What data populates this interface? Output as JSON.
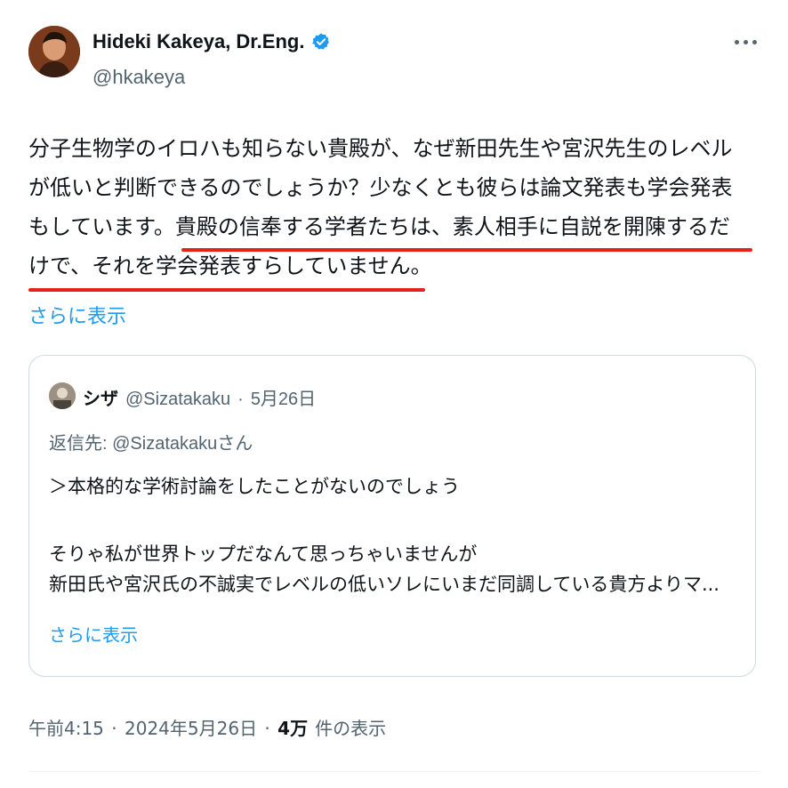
{
  "author": {
    "name": "Hideki Kakeya, Dr.Eng.",
    "handle": "@hkakeya"
  },
  "tweet": {
    "line1": "分子生物学のイロハも知らない貴殿が、なぜ新田先生や宮沢先生のレベル",
    "line2": "が低いと判断できるのでしょうか？少なくとも彼らは論文発表も学会発表",
    "line3_plain": "もしています。",
    "line3_highlight": "貴殿の信奉する学者たちは、素人相手に自説を開陳するだ",
    "line4_highlight": "けで、それを学会発表すらしていません。",
    "show_more": "さらに表示"
  },
  "quote": {
    "name": "シザ",
    "handle": "@Sizatakaku",
    "date": "5月26日",
    "reply_to": "返信先: @Sizatakakuさん",
    "lines": [
      "＞本格的な学術討論をしたことがないのでしょう",
      "そりゃ私が世界トップだなんて思っちゃいませんが",
      "新田氏や宮沢氏の不誠実でレベルの低いソレにいまだ同調している貴方よりマ..."
    ],
    "show_more": "さらに表示"
  },
  "meta": {
    "time": "午前4:15",
    "date": "2024年5月26日",
    "views_count": "4万",
    "views_label": "件の表示"
  },
  "colors": {
    "link": "#1d9bf0",
    "verified": "#1d9bf0",
    "underline": "#e3231b",
    "muted": "#536471"
  }
}
